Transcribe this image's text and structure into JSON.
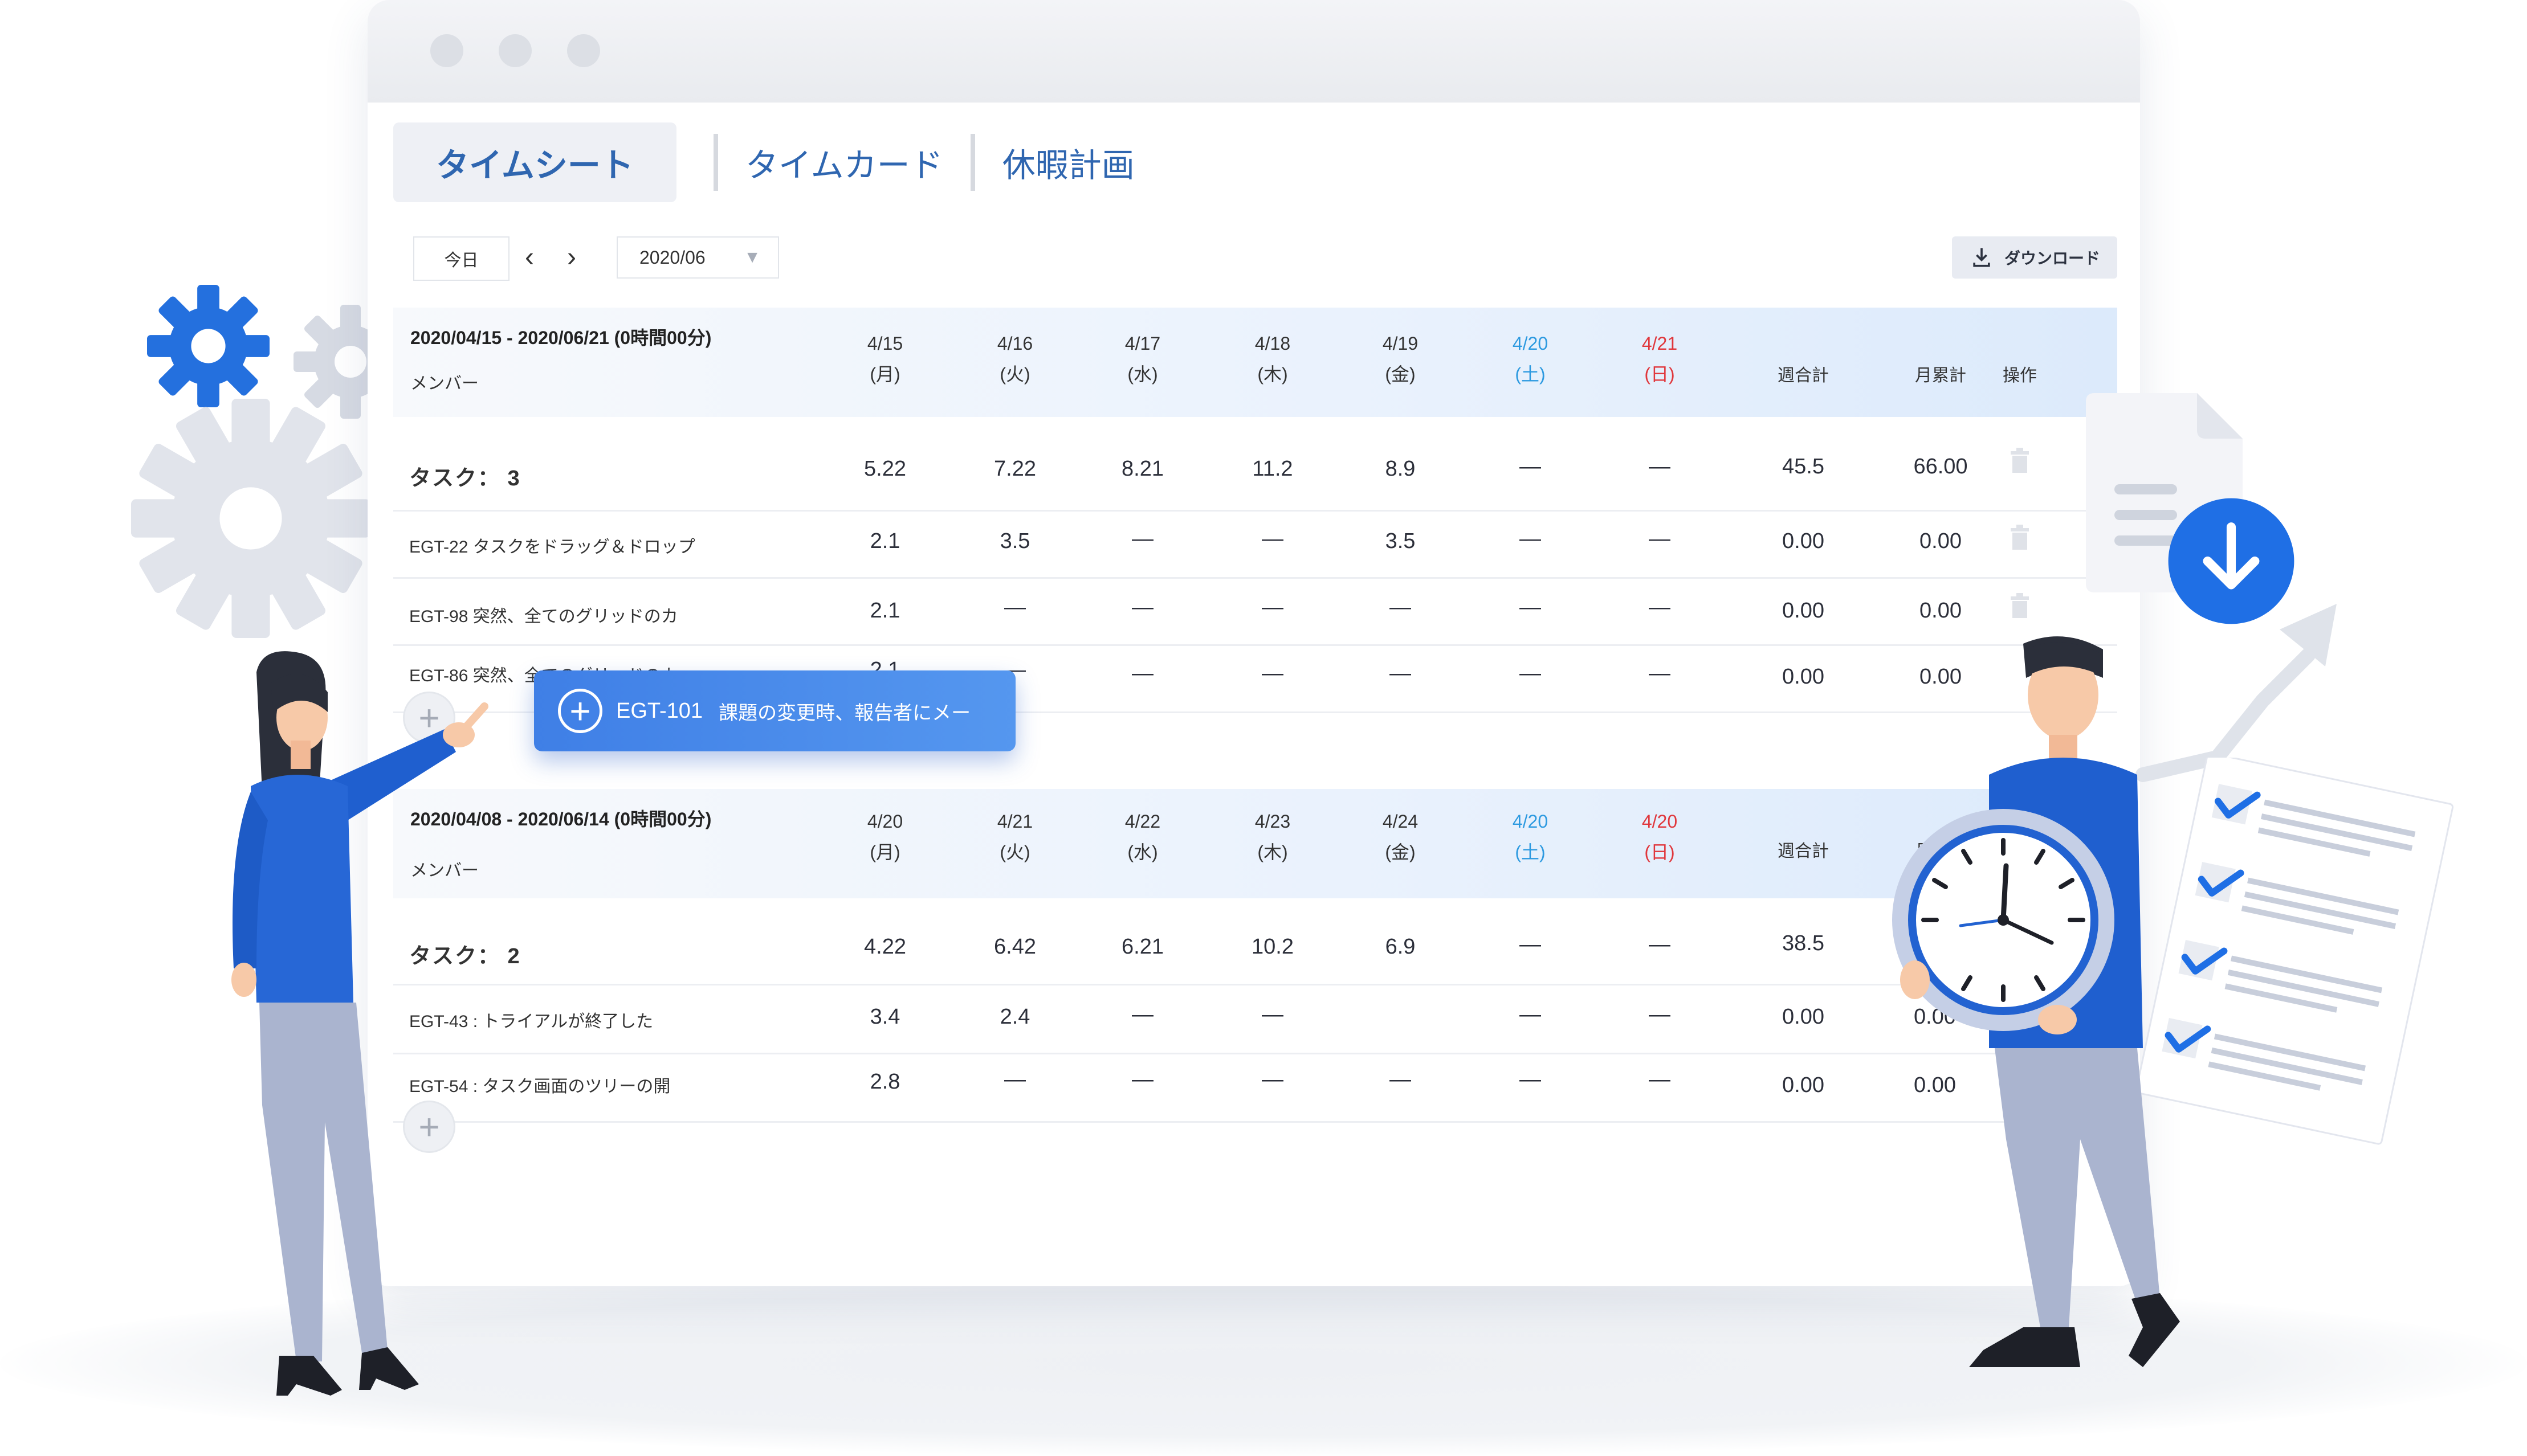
{
  "tabs": [
    {
      "label": "タイムシート",
      "active": true
    },
    {
      "label": "タイムカード",
      "active": false
    },
    {
      "label": "休暇計画",
      "active": false
    }
  ],
  "toolbar": {
    "today_label": "今日",
    "prev": "‹",
    "next": "›",
    "month": "2020/06",
    "download_label": "ダウンロード"
  },
  "sections": [
    {
      "range": "2020/04/15 - 2020/06/21 (0時間00分)",
      "member_label": "メンバー",
      "days": [
        {
          "date": "4/15",
          "weekday": "(月)"
        },
        {
          "date": "4/16",
          "weekday": "(火)"
        },
        {
          "date": "4/17",
          "weekday": "(水)"
        },
        {
          "date": "4/18",
          "weekday": "(木)"
        },
        {
          "date": "4/19",
          "weekday": "(金)"
        },
        {
          "date": "4/20",
          "weekday": "(土)"
        },
        {
          "date": "4/21",
          "weekday": "(日)"
        }
      ],
      "weekly_total_label": "週合計",
      "monthly_total_label": "月累計",
      "actions_label": "操作",
      "task_row": {
        "label": "タスク：  3",
        "values": [
          "5.22",
          "7.22",
          "8.21",
          "11.2",
          "8.9",
          "—",
          "—"
        ],
        "weekly": "45.5",
        "monthly": "66.00"
      },
      "rows": [
        {
          "name": "EGT-22  タスクをドラッグ＆ドロップ",
          "values": [
            "2.1",
            "3.5",
            "—",
            "—",
            "3.5",
            "—",
            "—"
          ],
          "weekly": "0.00",
          "monthly": "0.00"
        },
        {
          "name": "EGT-98  突然、全てのグリッドのカ",
          "values": [
            "2.1",
            "—",
            "—",
            "—",
            "—",
            "—",
            "—"
          ],
          "weekly": "0.00",
          "monthly": "0.00"
        },
        {
          "name": "EGT-86  突然、全てのグリッドのカ",
          "values": [
            "2.1",
            "—",
            "—",
            "—",
            "—",
            "—",
            "—"
          ],
          "weekly": "0.00",
          "monthly": "0.00"
        }
      ]
    },
    {
      "range": "2020/04/08 - 2020/06/14 (0時間00分)",
      "member_label": "メンバー",
      "days": [
        {
          "date": "4/20",
          "weekday": "(月)"
        },
        {
          "date": "4/21",
          "weekday": "(火)"
        },
        {
          "date": "4/22",
          "weekday": "(水)"
        },
        {
          "date": "4/23",
          "weekday": "(木)"
        },
        {
          "date": "4/24",
          "weekday": "(金)"
        },
        {
          "date": "4/20",
          "weekday": "(土)"
        },
        {
          "date": "4/20",
          "weekday": "(日)"
        }
      ],
      "weekly_total_label": "週合計",
      "monthly_total_label": "月累計",
      "task_row": {
        "label": "タスク：  2",
        "values": [
          "4.22",
          "6.42",
          "6.21",
          "10.2",
          "6.9",
          "—",
          "—"
        ],
        "weekly": "38.5",
        "monthly": ""
      },
      "rows": [
        {
          "name": "EGT-43 : トライアルが終了した",
          "values": [
            "3.4",
            "2.4",
            "—",
            "—",
            "",
            "—",
            "—"
          ],
          "weekly": "0.00",
          "monthly": "0.00"
        },
        {
          "name": "EGT-54 : タスク画面のツリーの開",
          "values": [
            "2.8",
            "—",
            "—",
            "—",
            "—",
            "—",
            "—"
          ],
          "weekly": "0.00",
          "monthly": "0.00"
        }
      ]
    }
  ],
  "drag_card": {
    "code": "EGT-101",
    "text": "課題の変更時、報告者にメー"
  },
  "icons": {
    "add": "plus-icon",
    "delete": "trash-icon",
    "download": "download-icon",
    "settings": "gear-icon"
  },
  "colors": {
    "accent": "#2f66b0",
    "saturday": "#2d9ae0",
    "sunday": "#e0373c",
    "drag_card": "#4a8cec"
  }
}
